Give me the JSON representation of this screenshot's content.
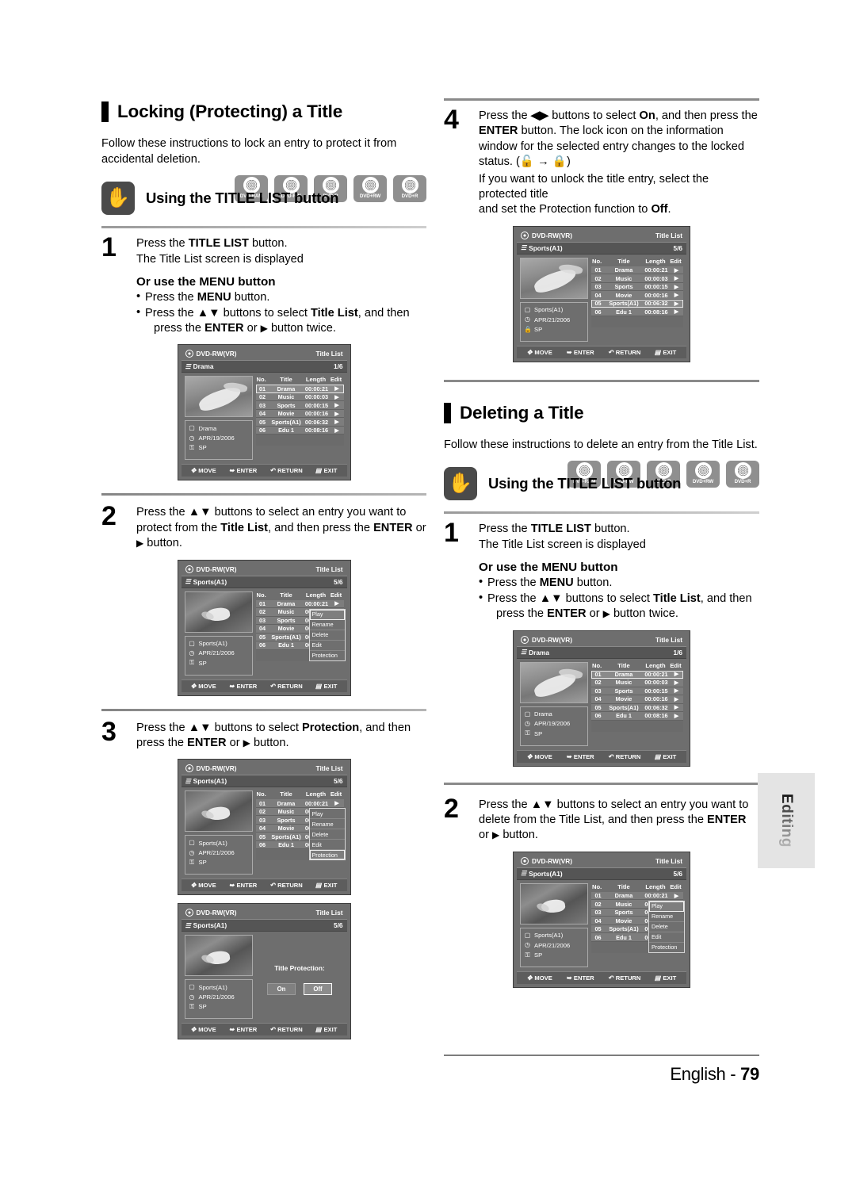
{
  "left_column": {
    "section": {
      "title": "Locking (Protecting) a Title",
      "intro": "Follow these instructions to lock an entry to protect it from accidental deletion.",
      "subhead": "Using the TITLE LIST button"
    },
    "discs": [
      "DVD-RAM",
      "DVD-RW",
      "DVD-R",
      "DVD+RW",
      "DVD+R"
    ],
    "steps": [
      {
        "num": "1",
        "line1_a": "Press the ",
        "line1_b": "TITLE LIST",
        "line1_c": " button.",
        "line2": "The Title List screen is displayed",
        "or_head": "Or use the MENU button",
        "bullet1_a": "Press the ",
        "bullet1_b": "MENU",
        "bullet1_c": " button.",
        "bullet2_a": "Press the ",
        "bullet2_b": "▲▼",
        "bullet2_c": " buttons to select ",
        "bullet2_d": "Title List",
        "bullet2_e": ", and then",
        "bullet2_f": "press the ",
        "bullet2_g": "ENTER",
        "bullet2_h": " or ",
        "bullet2_i": "▶",
        "bullet2_j": " button twice."
      },
      {
        "num": "2",
        "t1": "Press the ",
        "t2": "▲▼",
        "t3": " buttons to select an entry you want to protect from the ",
        "t4": "Title List",
        "t5": ", and then press the ",
        "t6": "ENTER",
        "t7": " or ",
        "t8": "▶",
        "t9": " button."
      },
      {
        "num": "3",
        "t1": "Press the ",
        "t2": "▲▼",
        "t3": " buttons to select ",
        "t4": "Protection",
        "t5": ", and then press the ",
        "t6": "ENTER",
        "t7": " or ",
        "t8": "▶",
        "t9": " button."
      }
    ]
  },
  "right_column": {
    "step4": {
      "num": "4",
      "t1": "Press the ",
      "t2": "◀▶",
      "t3": " buttons to select ",
      "t4": "On",
      "t5": ", and then press the ",
      "t6": "ENTER",
      "t7": " button. The lock icon on the information window for the selected entry changes to the locked status. (",
      "t8": " → ",
      "t9": ")",
      "note1": "If you want to unlock the title entry, select the protected title",
      "note2_a": "and set the Protection function to ",
      "note2_b": "Off",
      "note2_c": "."
    },
    "section": {
      "title": "Deleting a Title",
      "intro": "Follow these instructions to delete an entry from the Title List.",
      "subhead": "Using the TITLE LIST button"
    },
    "discs": [
      "DVD-RAM",
      "DVD-RW",
      "DVD-R",
      "DVD+RW",
      "DVD+R"
    ],
    "steps": [
      {
        "num": "1",
        "line1_a": "Press the ",
        "line1_b": "TITLE LIST",
        "line1_c": " button.",
        "line2": "The Title List screen is displayed",
        "or_head": "Or use the MENU button",
        "bullet1_a": "Press the ",
        "bullet1_b": "MENU",
        "bullet1_c": " button.",
        "bullet2_a": "Press the ",
        "bullet2_b": "▲▼",
        "bullet2_c": " buttons to select ",
        "bullet2_d": "Title List",
        "bullet2_e": ", and then",
        "bullet2_f": "press the ",
        "bullet2_g": "ENTER",
        "bullet2_h": " or ",
        "bullet2_i": "▶",
        "bullet2_j": " button twice."
      },
      {
        "num": "2",
        "t1": "Press the ",
        "t2": "▲▼",
        "t3": " buttons to select an entry you want to delete from the Title List, and then press the ",
        "t4": "ENTER",
        "t5": " or ",
        "t6": "▶",
        "t7": " button."
      }
    ]
  },
  "tv_common": {
    "disc_label": "DVD-RW(VR)",
    "screen_label": "Title List",
    "columns": {
      "no": "No.",
      "title": "Title",
      "length": "Length",
      "edit": "Edit"
    },
    "rows": [
      {
        "no": "01",
        "title": "Drama",
        "length": "00:00:21",
        "edit": "▶"
      },
      {
        "no": "02",
        "title": "Music",
        "length": "00:00:03",
        "edit": "▶"
      },
      {
        "no": "03",
        "title": "Sports",
        "length": "00:00:15",
        "edit": "▶"
      },
      {
        "no": "04",
        "title": "Movie",
        "length": "00:00:16",
        "edit": "▶"
      },
      {
        "no": "05",
        "title": "Sports(A1)",
        "length": "00:06:32",
        "edit": "▶"
      },
      {
        "no": "06",
        "title": "Edu 1",
        "length": "00:08:16",
        "edit": "▶"
      }
    ],
    "bottom_bar": {
      "move": "MOVE",
      "enter": "ENTER",
      "return": "RETURN",
      "exit": "EXIT",
      "move_icon": "✥",
      "enter_icon": "➥",
      "return_icon": "↶",
      "exit_icon": "▤"
    },
    "popup_items": [
      "Play",
      "Rename",
      "Delete",
      "Edit",
      "Protection"
    ],
    "protection": {
      "label": "Title Protection:",
      "on": "On",
      "off": "Off"
    }
  },
  "tv_screens": {
    "s1_drama": {
      "title": "Drama",
      "counter": "1/6",
      "info_name": "Drama",
      "info_date": "APR/19/2006",
      "info_mode": "SP",
      "lock": "⚿"
    },
    "s2_sports": {
      "title": "Sports(A1)",
      "counter": "5/6",
      "info_name": "Sports(A1)",
      "info_date": "APR/21/2006",
      "info_mode": "SP",
      "lock": "⚿"
    },
    "s3_protect": {
      "title": "Sports(A1)",
      "counter": "5/6",
      "info_name": "Sports(A1)",
      "info_date": "APR/21/2006",
      "info_mode": "SP",
      "lock": "⚿"
    },
    "s4_locked": {
      "title": "Sports(A1)",
      "counter": "5/6",
      "info_name": "Sports(A1)",
      "info_date": "APR/21/2006",
      "info_mode": "SP",
      "lock": "🔒"
    }
  },
  "side_tab": {
    "label": "Editing"
  },
  "footer": {
    "language": "English - ",
    "page": "79"
  }
}
